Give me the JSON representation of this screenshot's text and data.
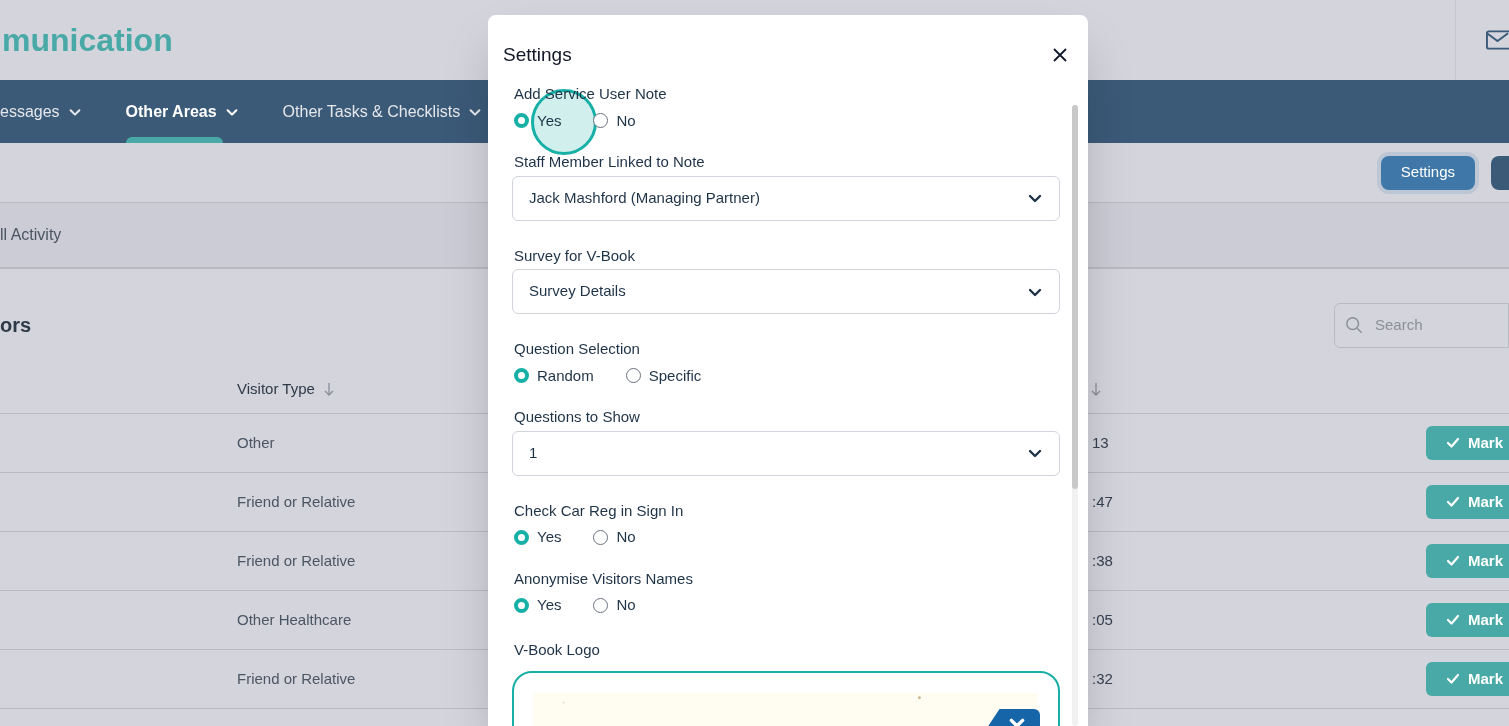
{
  "header": {
    "title": "munication"
  },
  "nav": [
    {
      "label": "essages",
      "selected": false
    },
    {
      "label": "Other Areas",
      "selected": true
    },
    {
      "label": "Other Tasks & Checklists",
      "selected": false
    }
  ],
  "toolbar": {
    "settings_button": "Settings"
  },
  "subtabs": [
    {
      "label": "ll Activity",
      "selected": false
    }
  ],
  "section": {
    "title": "ors",
    "search": {
      "placeholder": "Search"
    }
  },
  "table": {
    "columns": [
      "Visitor Type"
    ],
    "rows": [
      {
        "visitor_type": "Other",
        "time": "13",
        "action": "Mark"
      },
      {
        "visitor_type": "Friend or Relative",
        "time": ":47",
        "action": "Mark"
      },
      {
        "visitor_type": "Friend or Relative",
        "time": ":38",
        "action": "Mark"
      },
      {
        "visitor_type": "Other Healthcare",
        "time": ":05",
        "action": "Mark"
      },
      {
        "visitor_type": "Friend or Relative",
        "time": ":32",
        "action": "Mark"
      }
    ]
  },
  "modal": {
    "title": "Settings",
    "fields": [
      {
        "kind": "radio",
        "label": "Add Service User Note",
        "options": [
          {
            "label": "Yes",
            "selected": true
          },
          {
            "label": "No",
            "selected": false
          }
        ]
      },
      {
        "kind": "select",
        "label": "Staff Member Linked to Note",
        "value": "Jack Mashford (Managing Partner)"
      },
      {
        "kind": "select",
        "label": "Survey for V-Book",
        "value": "Survey Details"
      },
      {
        "kind": "radio",
        "label": "Question Selection",
        "options": [
          {
            "label": "Random",
            "selected": true
          },
          {
            "label": "Specific",
            "selected": false
          }
        ]
      },
      {
        "kind": "select",
        "label": "Questions to Show",
        "value": "1"
      },
      {
        "kind": "radio",
        "label": "Check Car Reg in Sign In",
        "options": [
          {
            "label": "Yes",
            "selected": true
          },
          {
            "label": "No",
            "selected": false
          }
        ]
      },
      {
        "kind": "radio",
        "label": "Anonymise Visitors Names",
        "options": [
          {
            "label": "Yes",
            "selected": true
          },
          {
            "label": "No",
            "selected": false
          }
        ]
      },
      {
        "label": "V-Book Logo"
      }
    ]
  }
}
